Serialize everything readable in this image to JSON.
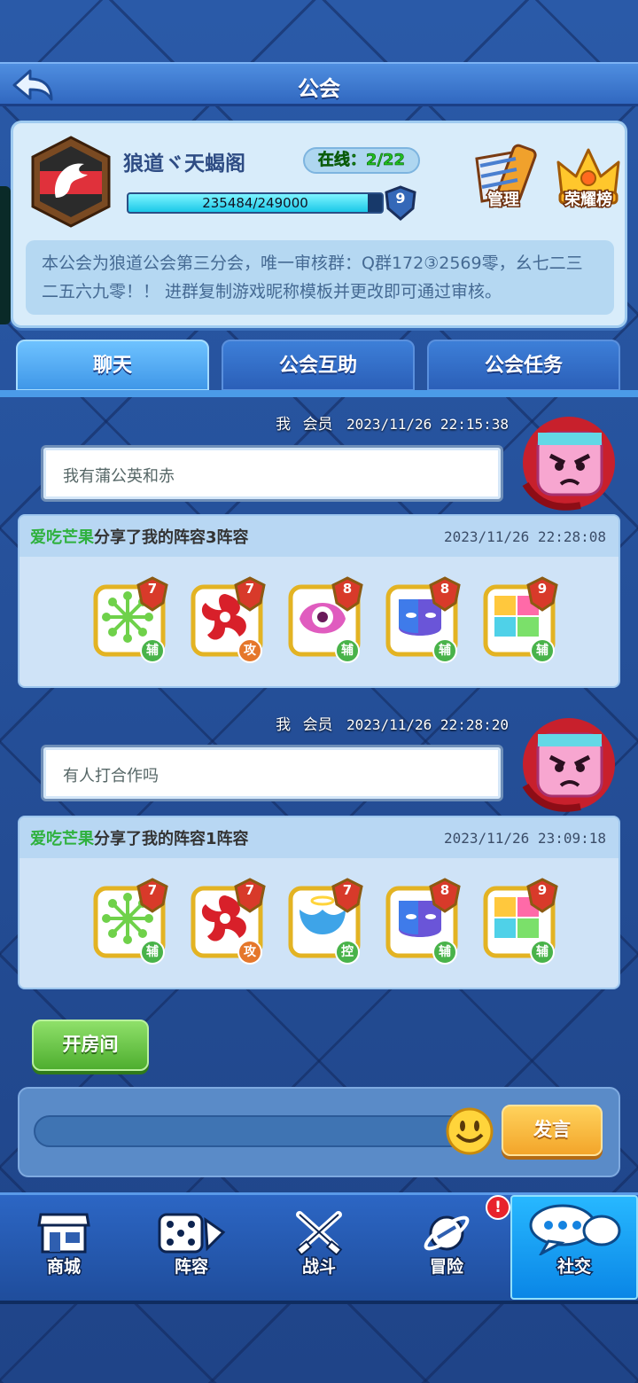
{
  "header": {
    "title": "公会",
    "back_icon": "back-arrow-icon"
  },
  "guild": {
    "name": "狼道ヾ天蝎阁",
    "online_label": "在线：2/22",
    "xp_text": "235484/249000",
    "xp_current": 235484,
    "xp_max": 249000,
    "level": "9",
    "manage_label": "管理",
    "honor_label": "荣耀榜",
    "notice": "本公会为狼道公会第三分会，唯一审核群：Q群172③2569零，幺七二三二五六九零！！ 进群复制游戏昵称模板并更改即可通过审核。"
  },
  "tabs": [
    {
      "label": "聊天"
    },
    {
      "label": "公会互助"
    },
    {
      "label": "公会任务"
    }
  ],
  "messages": [
    {
      "sender": "我",
      "role": "会员",
      "time": "2023/11/26 22:15:38",
      "text": "我有蒲公英和赤"
    },
    {
      "user": "爱吃芒果",
      "text": "分享了我的阵容3阵容",
      "time": "2023/11/26 22:28:08",
      "units": [
        {
          "level": "7",
          "role": "辅",
          "icon": "dandelion-icon",
          "color": "#6fd14a"
        },
        {
          "level": "7",
          "role": "攻",
          "icon": "red-shuriken-icon",
          "color": "#d8202a"
        },
        {
          "level": "8",
          "role": "辅",
          "icon": "pink-eye-icon",
          "color": "#e05cbf"
        },
        {
          "level": "8",
          "role": "辅",
          "icon": "purple-mask-icon",
          "color": "#6a55d8"
        },
        {
          "level": "9",
          "role": "辅",
          "icon": "rainbow-puzzle-icon",
          "color": "#e9a9f2"
        }
      ]
    },
    {
      "sender": "我",
      "role": "会员",
      "time": "2023/11/26 22:28:20",
      "text": "有人打合作吗"
    },
    {
      "user": "爱吃芒果",
      "text": "分享了我的阵容1阵容",
      "time": "2023/11/26 23:09:18",
      "units": [
        {
          "level": "7",
          "role": "辅",
          "icon": "dandelion-icon",
          "color": "#6fd14a"
        },
        {
          "level": "7",
          "role": "攻",
          "icon": "red-shuriken-icon",
          "color": "#d8202a"
        },
        {
          "level": "7",
          "role": "控",
          "icon": "angel-wing-icon",
          "color": "#3ea4e8"
        },
        {
          "level": "8",
          "role": "辅",
          "icon": "purple-mask-icon",
          "color": "#6a55d8"
        },
        {
          "level": "9",
          "role": "辅",
          "icon": "rainbow-puzzle-icon",
          "color": "#e9a9f2"
        }
      ]
    }
  ],
  "bottom": {
    "open_room": "开房间",
    "send": "发言",
    "input_placeholder": ""
  },
  "nav": [
    {
      "label": "商城",
      "icon": "shop-icon"
    },
    {
      "label": "阵容",
      "icon": "dice-icon"
    },
    {
      "label": "战斗",
      "icon": "crossed-swords-icon"
    },
    {
      "label": "冒险",
      "icon": "planet-icon"
    },
    {
      "label": "社交",
      "icon": "chat-bubbles-icon"
    }
  ],
  "badge": "!"
}
